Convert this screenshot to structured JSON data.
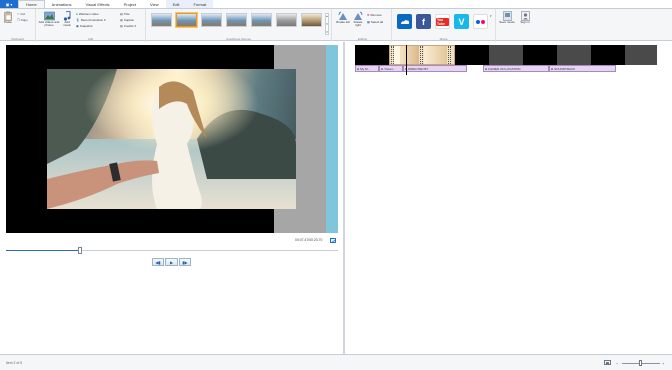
{
  "tabs": {
    "file_icon": "movie-maker-icon",
    "items": [
      "Home",
      "Animations",
      "Visual Effects",
      "Project",
      "View",
      "Edit",
      "Format"
    ]
  },
  "ribbon": {
    "clipboard": {
      "label": "Clipboard",
      "paste": "Paste",
      "cut": "Cut",
      "copy": "Copy"
    },
    "add": {
      "label": "Add",
      "add_videos": "Add videos and photos",
      "add_music": "Add music",
      "webcam": "Webcam video",
      "narration": "Record narration",
      "snapshot": "Snapshot",
      "title": "Title",
      "caption": "Caption",
      "credits": "Credits"
    },
    "automovie": {
      "label": "AutoMovie themes"
    },
    "editing": {
      "label": "Editing",
      "rotate_left": "Rotate left",
      "rotate_right": "Rotate right",
      "remove": "Remove",
      "select_all": "Select all"
    },
    "share": {
      "label": "Share",
      "services": [
        {
          "name": "onedrive-icon",
          "color": "#0a6ac2"
        },
        {
          "name": "facebook-icon",
          "color": "#3b5998"
        },
        {
          "name": "youtube-icon",
          "color": "#e52d27"
        },
        {
          "name": "vimeo-icon",
          "color": "#1ab7ea"
        },
        {
          "name": "flickr-icon",
          "color": "#4a78c8"
        }
      ],
      "youtube_text": "You Tube"
    },
    "save_movie": "Save movie",
    "sign_in": "Sign in"
  },
  "preview": {
    "timecode": "00:07.47/00:23.70"
  },
  "storyboard": {
    "captions": [
      "My M...",
      "Travel...",
      "DIRECTED BY",
      "FILMED ON LOCATION",
      "SOUNDTRACK"
    ]
  },
  "status": {
    "text": "Item 2 of 5"
  },
  "colors": {
    "accent": "#1e6fd0",
    "caption_bg": "#e6d4f3",
    "selected_theme_border": "#e59a2e"
  }
}
